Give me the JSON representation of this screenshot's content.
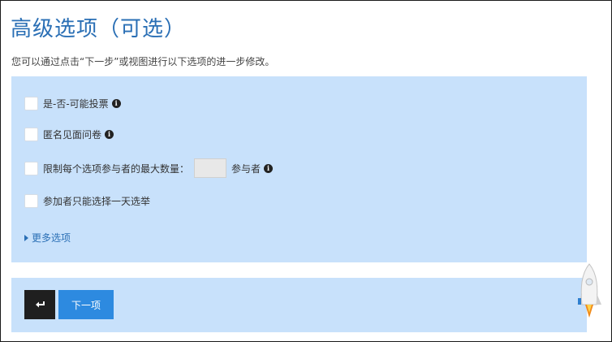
{
  "page": {
    "title": "高级选项（可选）",
    "subtitle": "您可以通过点击“下一步”或视图进行以下选项的进一步修改。"
  },
  "options": [
    {
      "label": "是-否-可能投票",
      "has_info": true
    },
    {
      "label": "匿名见面问卷",
      "has_info": true
    },
    {
      "label": "限制每个选项参与者的最大数量：",
      "suffix": "参与者",
      "has_info": true,
      "input_value": ""
    },
    {
      "label": "参加者只能选择一天选举",
      "has_info": false
    }
  ],
  "more_options": {
    "label": "更多选项"
  },
  "nav": {
    "next_label": "下一项"
  },
  "icons": {
    "info": "info-circle-icon",
    "back": "return-arrow-icon",
    "caret": "caret-right-icon",
    "rocket": "rocket-icon"
  },
  "colors": {
    "title": "#2a6fb5",
    "panel_background": "#c8e1fb",
    "next_button": "#2d8ae0",
    "back_button": "#1f1f1f"
  }
}
